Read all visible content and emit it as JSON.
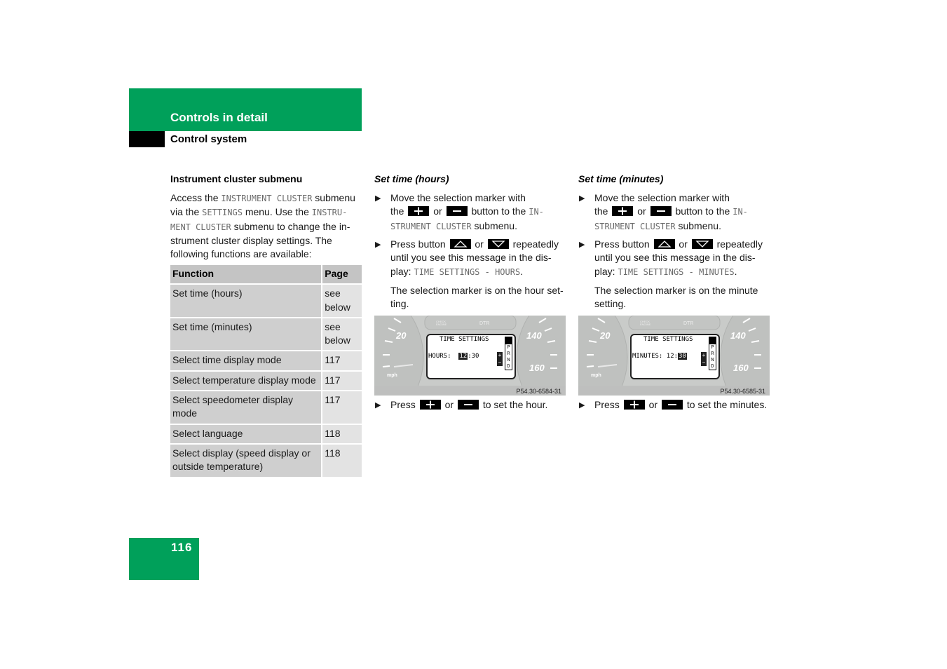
{
  "header": {
    "chapter": "Controls in detail",
    "section": "Control system"
  },
  "colors": {
    "accent": "#00a05a",
    "black": "#000000"
  },
  "col1": {
    "heading": "Instrument cluster submenu",
    "intro": [
      {
        "t": "Access the ",
        "m": false
      },
      {
        "t": "INSTRUMENT CLUSTER",
        "m": true
      },
      {
        "t": " submenu via the ",
        "m": false
      },
      {
        "t": "SETTINGS",
        "m": true
      },
      {
        "t": " menu. Use the ",
        "m": false
      },
      {
        "t": "INSTRU-MENT CLUSTER",
        "m": true
      },
      {
        "t": " submenu to change the in-strument cluster display settings. The following functions are available:",
        "m": false
      }
    ],
    "table": {
      "headers": [
        "Function",
        "Page"
      ],
      "rows": [
        [
          "Set time (hours)",
          "see below"
        ],
        [
          "Set time (minutes)",
          "see below"
        ],
        [
          "Select time display mode",
          "117"
        ],
        [
          "Select temperature display mode",
          "117"
        ],
        [
          "Select speedometer display mode",
          "117"
        ],
        [
          "Select language",
          "118"
        ],
        [
          "Select display (speed display or outside temperature)",
          "118"
        ]
      ]
    }
  },
  "col2": {
    "heading": "Set time (hours)",
    "step1": {
      "a": "Move the selection marker with",
      "b": "the",
      "or": "or",
      "c": "button to the",
      "m1": "IN-",
      "m2": "STRUMENT CLUSTER",
      "d": "submenu."
    },
    "step2": {
      "a": "Press button",
      "or": "or",
      "b": "repeatedly",
      "c": "until you see this message in the dis-",
      "d": "play:",
      "m": "TIME SETTINGS - HOURS",
      "e": "."
    },
    "note": [
      "The selection marker is on the hour set-",
      "ting."
    ],
    "display": {
      "title": "TIME SETTINGS",
      "label": "HOURS:",
      "hours": "12",
      "sep": ":",
      "minutes": "30",
      "gears": [
        "P",
        "R",
        "N",
        "D"
      ],
      "speeds": [
        "20",
        "140",
        "160"
      ],
      "unit": "mph",
      "code": "P54.30-6584-31",
      "selected": "hours"
    },
    "step3": {
      "a": "Press",
      "or": "or",
      "b": "to set the hour."
    }
  },
  "col3": {
    "heading": "Set time (minutes)",
    "step1": {
      "a": "Move the selection marker with",
      "b": "the",
      "or": "or",
      "c": "button to the",
      "m1": "IN-",
      "m2": "STRUMENT CLUSTER",
      "d": "submenu."
    },
    "step2": {
      "a": "Press button",
      "or": "or",
      "b": "repeatedly",
      "c": "until you see this message in the dis-",
      "d": "play:",
      "m": "TIME SETTINGS - MINUTES",
      "e": "."
    },
    "note": [
      "The selection marker is on the minute",
      "setting."
    ],
    "display": {
      "title": "TIME SETTINGS",
      "label": "MINUTES:",
      "hours": "12",
      "sep": ":",
      "minutes": "30",
      "gears": [
        "P",
        "R",
        "N",
        "D"
      ],
      "speeds": [
        "20",
        "140",
        "160"
      ],
      "unit": "mph",
      "code": "P54.30-6585-31",
      "selected": "minutes"
    },
    "step3": {
      "a": "Press",
      "or": "or",
      "b": "to set the minutes."
    }
  },
  "icons": {
    "bullet": "triangle-right",
    "plus": "plus-key",
    "minus": "minus-key",
    "up": "up-arrow-key",
    "down": "down-arrow-key"
  },
  "footer": {
    "page_number": "116"
  }
}
